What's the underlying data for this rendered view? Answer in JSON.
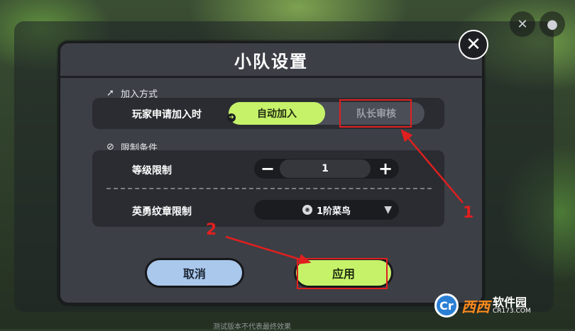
{
  "dialog": {
    "title": "小队设置",
    "close_icon": "close-x-icon"
  },
  "join_section": {
    "label": "加入方式",
    "icon": "cursor-plus-icon",
    "row_label": "玩家申请加入时",
    "options": [
      "自动加入",
      "队长审核"
    ],
    "selected": "自动加入"
  },
  "limit_section": {
    "label": "限制条件",
    "icon": "ban-icon",
    "level_label": "等级限制",
    "level_value": "1",
    "minus": "−",
    "plus": "+",
    "badge_label": "英勇纹章限制",
    "badge_value": "1阶菜鸟"
  },
  "buttons": {
    "cancel": "取消",
    "apply": "应用"
  },
  "annotations": {
    "num1": "1",
    "num2": "2",
    "color": "#e01f1f"
  },
  "watermark": {
    "logo": "Cr",
    "name": "西西",
    "site": "软件园",
    "url": "CR173.COM"
  },
  "background": {
    "hint": "测试版本不代表最终效果"
  },
  "colors": {
    "accent_green": "#c6f26a",
    "cancel_blue": "#a9c8ec",
    "dialog_bg": "#3c3f45"
  }
}
